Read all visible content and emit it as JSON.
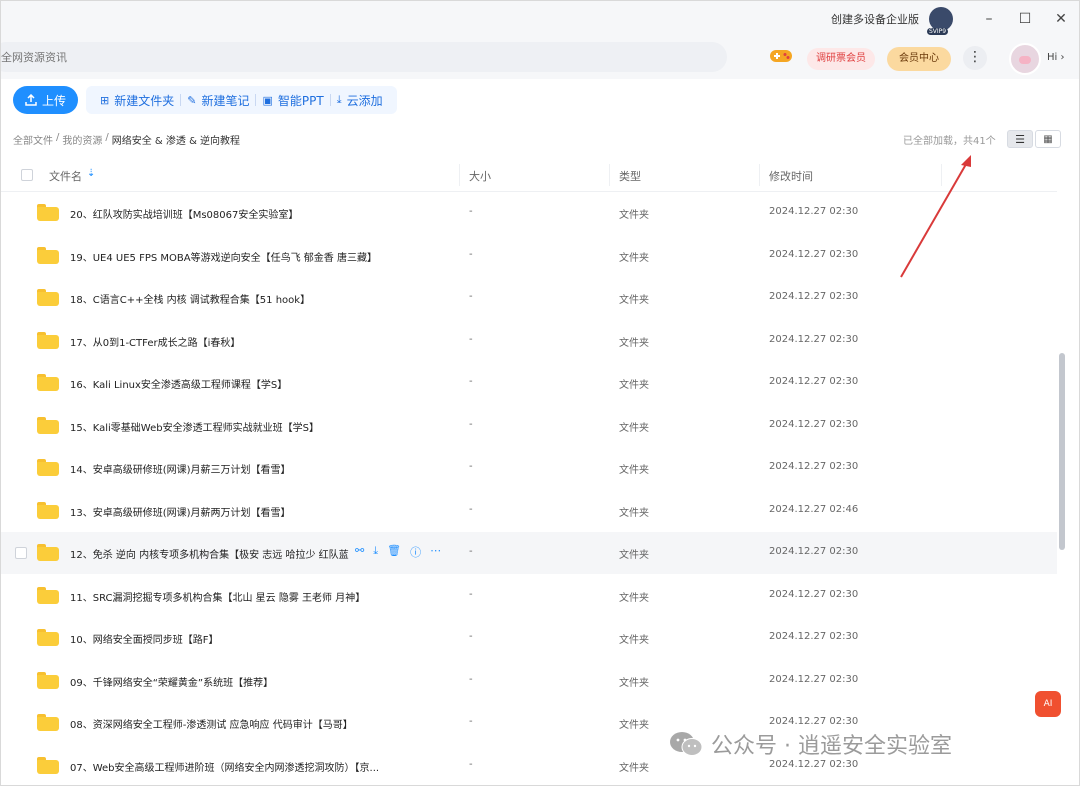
{
  "titlebar": {
    "enterprise_label": "创建多设备企业版",
    "badge": "SVIP9",
    "minimize_glyph": "–",
    "maximize_glyph": "☐",
    "close_glyph": "✕"
  },
  "topbar": {
    "search_placeholder": "全网资源资讯",
    "research_vip_label": "调研票会员",
    "member_center_label": "会员中心",
    "more_glyph": "⋮",
    "greeting": "Hi ›"
  },
  "toolbar": {
    "upload_label": "上传",
    "new_folder_label": "新建文件夹",
    "new_note_label": "新建笔记",
    "smart_ppt_label": "智能PPT",
    "cloud_add_label": "云添加"
  },
  "breadcrumb": {
    "root": "全部文件",
    "sep1": "/",
    "level1": "我的资源",
    "sep2": "/",
    "current": "网络安全 & 渗透 & 逆向教程"
  },
  "status": {
    "loaded_text": "已全部加载，共41个"
  },
  "table": {
    "headers": {
      "name": "文件名",
      "size": "大小",
      "type": "类型",
      "modified": "修改时间"
    },
    "rows": [
      {
        "name": "20、红队攻防实战培训班【Ms08067安全实验室】",
        "size": "-",
        "type": "文件夹",
        "date": "2024.12.27 02:30"
      },
      {
        "name": "19、UE4 UE5 FPS MOBA等游戏逆向安全【任鸟飞 郁金香 唐三藏】",
        "size": "-",
        "type": "文件夹",
        "date": "2024.12.27 02:30"
      },
      {
        "name": "18、C语言C++全栈 内核 调试教程合集【51 hook】",
        "size": "-",
        "type": "文件夹",
        "date": "2024.12.27 02:30"
      },
      {
        "name": "17、从0到1-CTFer成长之路【i春秋】",
        "size": "-",
        "type": "文件夹",
        "date": "2024.12.27 02:30"
      },
      {
        "name": "16、Kali Linux安全渗透高级工程师课程【学S】",
        "size": "-",
        "type": "文件夹",
        "date": "2024.12.27 02:30"
      },
      {
        "name": "15、Kali零基础Web安全渗透工程师实战就业班【学S】",
        "size": "-",
        "type": "文件夹",
        "date": "2024.12.27 02:30"
      },
      {
        "name": "14、安卓高级研修班(网课)月薪三万计划【看雪】",
        "size": "-",
        "type": "文件夹",
        "date": "2024.12.27 02:30"
      },
      {
        "name": "13、安卓高级研修班(网课)月薪两万计划【看雪】",
        "size": "-",
        "type": "文件夹",
        "date": "2024.12.27 02:46"
      },
      {
        "name": "12、免杀 逆向 内核专项多机构合集【极安 志远 哈拉少 红队蓝",
        "size": "-",
        "type": "文件夹",
        "date": "2024.12.27 02:30"
      },
      {
        "name": "11、SRC漏洞挖掘专项多机构合集【北山 星云 隐雾 王老师 月神】",
        "size": "-",
        "type": "文件夹",
        "date": "2024.12.27 02:30"
      },
      {
        "name": "10、网络安全面授同步班【路F】",
        "size": "-",
        "type": "文件夹",
        "date": "2024.12.27 02:30"
      },
      {
        "name": "09、千锋网络安全“荣耀黄金”系统班【推荐】",
        "size": "-",
        "type": "文件夹",
        "date": "2024.12.27 02:30"
      },
      {
        "name": "08、资深网络安全工程师-渗透测试 应急响应 代码审计【马哥】",
        "size": "-",
        "type": "文件夹",
        "date": "2024.12.27 02:30"
      },
      {
        "name": "07、Web安全高级工程师进阶班（网络安全内网渗透挖洞攻防）【京...",
        "size": "-",
        "type": "文件夹",
        "date": "2024.12.27 02:30"
      }
    ]
  },
  "float": {
    "ai_label": "AI"
  },
  "watermark": {
    "text": "公众号 · 逍遥安全实验室"
  },
  "colors": {
    "accent": "#1f8fff",
    "folder": "#fbcd3a",
    "annotation": "#d93a3a"
  }
}
